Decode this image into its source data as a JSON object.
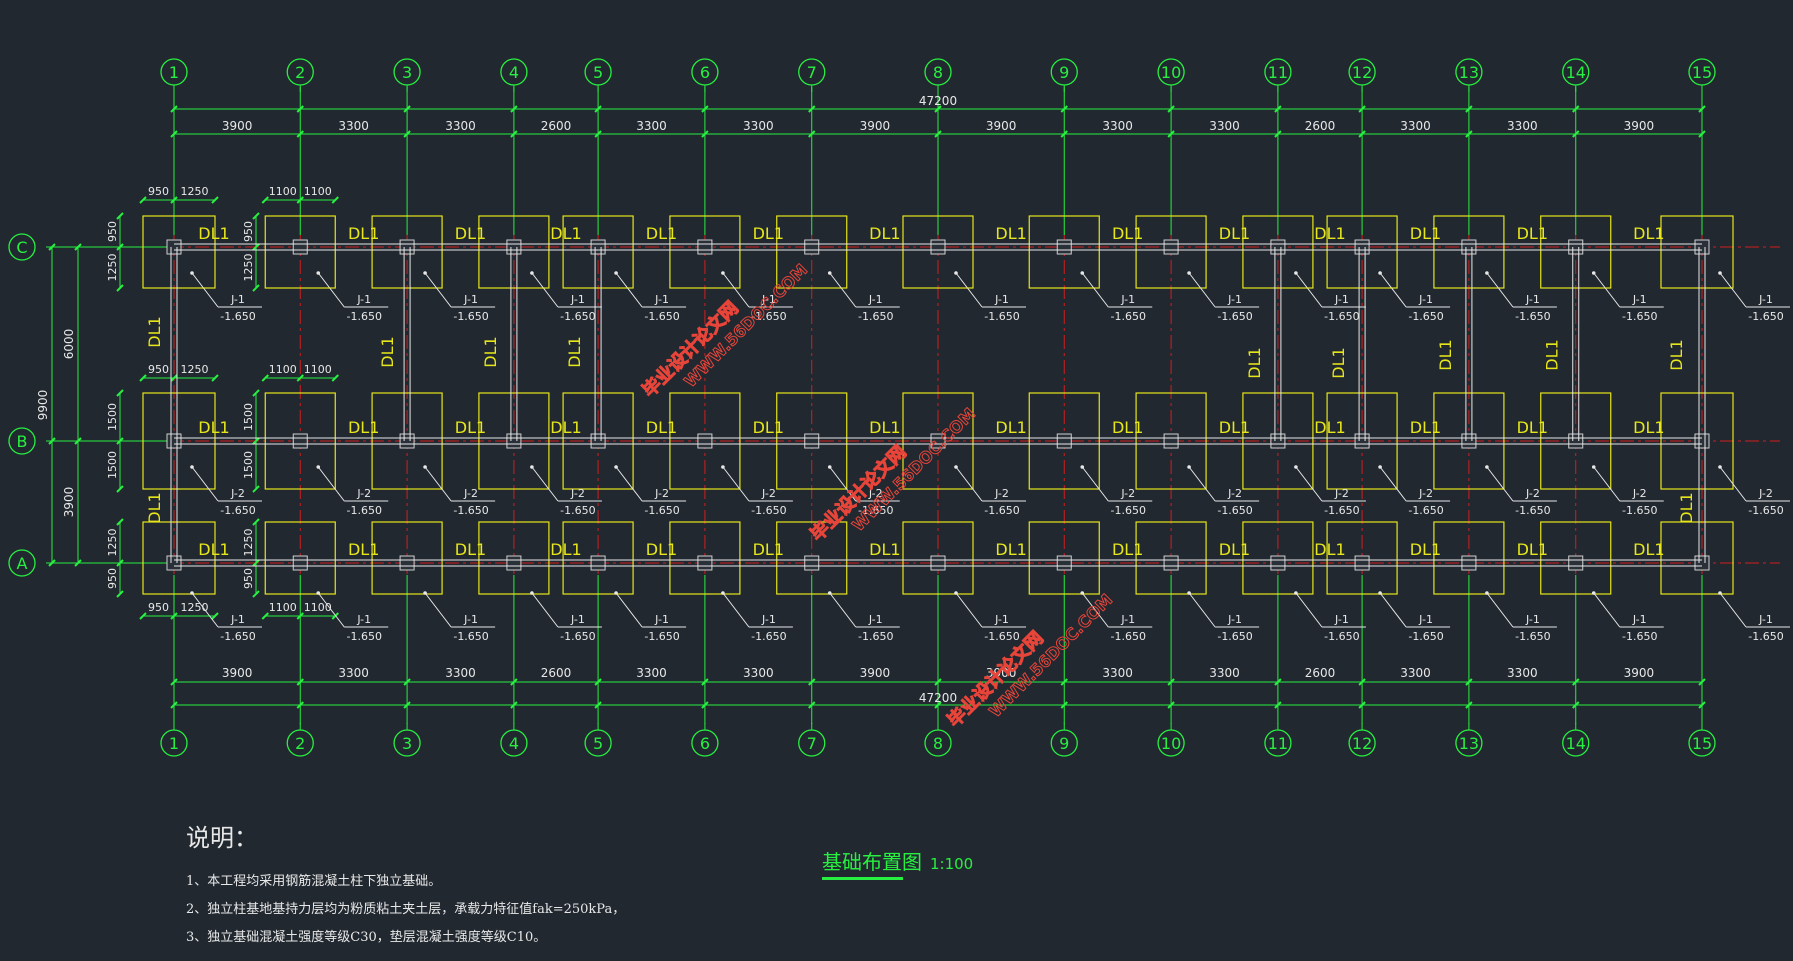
{
  "title": "基础布置图",
  "scale": "1:100",
  "notes": {
    "heading": "说明：",
    "items": [
      "1、本工程均采用钢筋混凝土柱下独立基础。",
      "2、独立柱基地基持力层均为粉质粘土夹土层，承载力特征值fak=250kPa，",
      "3、独立基础混凝土强度等级C30，垫层混凝土强度等级C10。"
    ]
  },
  "grid": {
    "columns": [
      "1",
      "2",
      "3",
      "4",
      "5",
      "6",
      "7",
      "8",
      "9",
      "10",
      "11",
      "12",
      "13",
      "14",
      "15"
    ],
    "rows": [
      "C",
      "B",
      "A"
    ],
    "bay_spacings": [
      3900,
      3300,
      3300,
      2600,
      3300,
      3300,
      3900,
      3900,
      3300,
      3300,
      2600,
      3300,
      3300,
      3900
    ],
    "total_length": "47200",
    "row_spacings": {
      "C_to_B": "6000",
      "B_to_A": "3900",
      "total": "9900"
    }
  },
  "footings": {
    "J1": {
      "label": "J-1",
      "elevation": "-1.650"
    },
    "J2": {
      "label": "J-2",
      "elevation": "-1.650"
    },
    "edge_dims_top": [
      "950",
      "1250"
    ],
    "interior_dims_top": [
      "1100",
      "1100"
    ],
    "row_C_depth": [
      "950",
      "1250"
    ],
    "row_B_depth": [
      "1500",
      "1500"
    ],
    "row_A_depth": [
      "1250",
      "950"
    ]
  },
  "beam_label": "DL1",
  "watermark": {
    "cn": "毕业设计论文网",
    "url": "WWW.56DOC.COM"
  },
  "colors": {
    "background": "#212830",
    "grid_green": "#27f040",
    "footing_yellow": "#e6e61a",
    "axis_red": "#d21e1e",
    "beam_white": "#e8e8e8",
    "watermark_red": "#e8453a"
  }
}
